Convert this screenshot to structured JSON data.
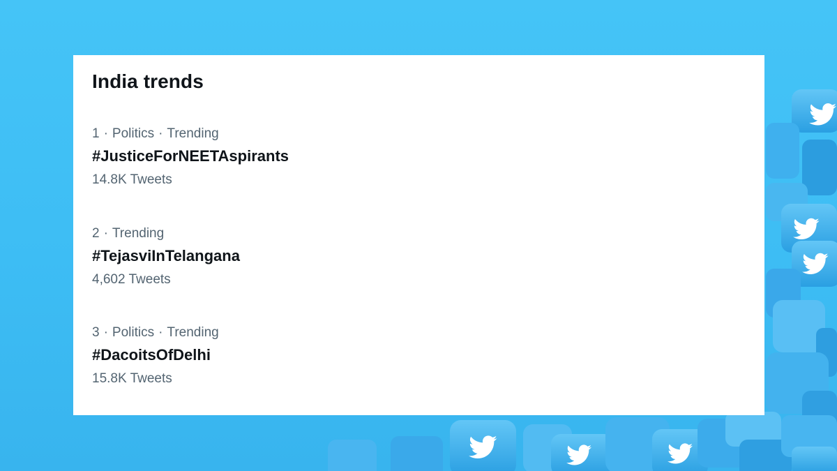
{
  "panel": {
    "title": "India trends"
  },
  "trends": [
    {
      "rank": "1",
      "category": "Politics",
      "status": "Trending",
      "name": "#JusticeForNEETAspirants",
      "count": "14.8K Tweets"
    },
    {
      "rank": "2",
      "category": "",
      "status": "Trending",
      "name": "#TejasviInTelangana",
      "count": "4,602 Tweets"
    },
    {
      "rank": "3",
      "category": "Politics",
      "status": "Trending",
      "name": "#DacoitsOfDelhi",
      "count": "15.8K Tweets"
    }
  ],
  "colors": {
    "background": "#3dbdf4",
    "card": "#ffffff",
    "primary_text": "#0f1419",
    "secondary_text": "#536471",
    "bird_tile": "#4fb4ef"
  },
  "decor": {
    "background_icon": "twitter-bird-icon"
  }
}
